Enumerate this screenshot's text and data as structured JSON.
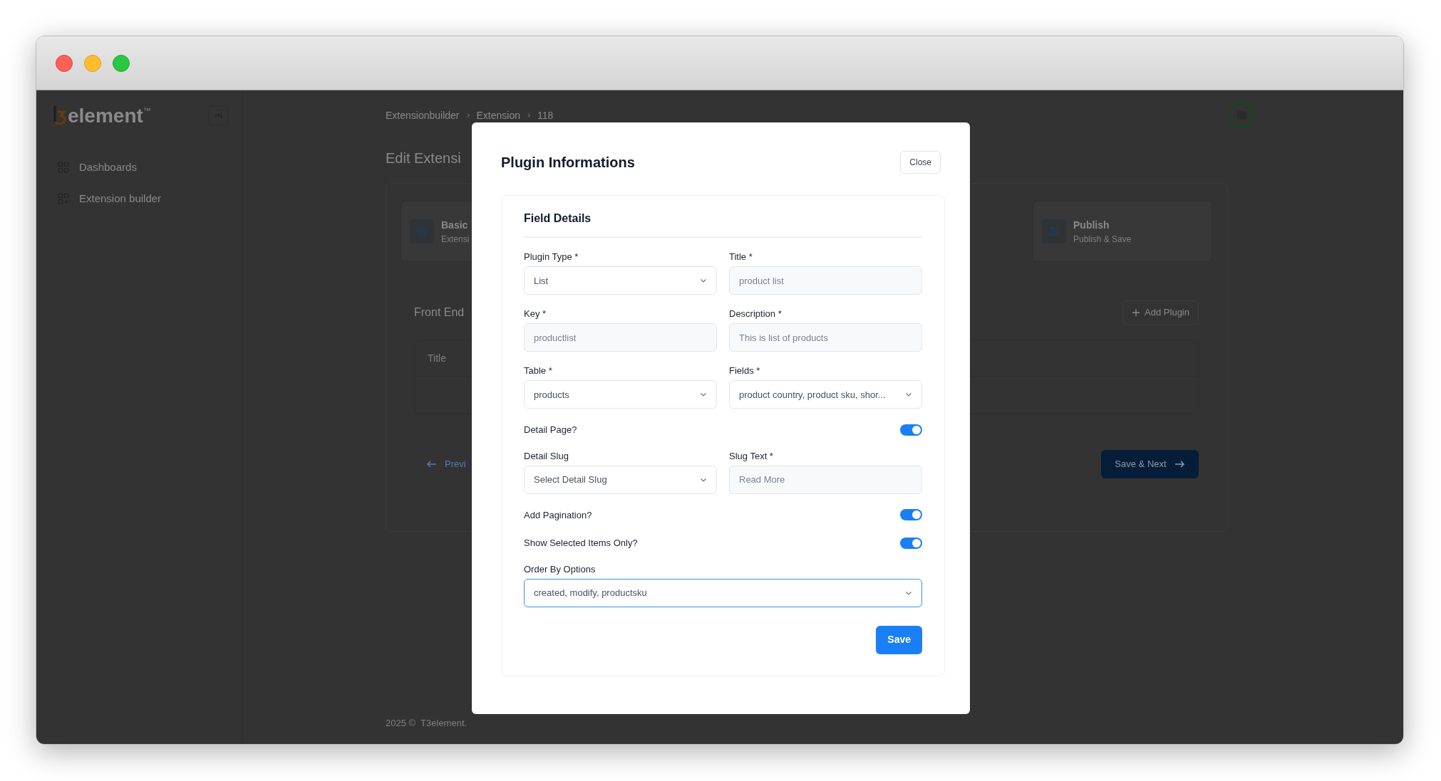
{
  "app": {
    "logo": {
      "text": "element",
      "mark": "™"
    },
    "sidebar": {
      "items": [
        {
          "label": "Dashboards"
        },
        {
          "label": "Extension builder"
        }
      ]
    },
    "breadcrumb": [
      "Extensionbuilder",
      "Extension",
      "118"
    ],
    "page_title": "Edit Extensi",
    "steps": [
      {
        "title": "Basic",
        "subtitle": "Extensi"
      },
      {
        "title": "Publish",
        "subtitle": "Publish & Save"
      }
    ],
    "section_title": "Front End",
    "add_button": "Add Plugin",
    "table": {
      "columns": [
        "Title"
      ]
    },
    "prev_button": "Previ",
    "next_button": "Save & Next",
    "footer": "2025 ©  T3element."
  },
  "modal": {
    "title": "Plugin Informations",
    "close": "Close",
    "card": {
      "title": "Field Details",
      "rows": [
        [
          {
            "kind": "select",
            "label": "Plugin Type *",
            "value": "List",
            "focused": false
          },
          {
            "kind": "input",
            "label": "Title *",
            "placeholder": "product list",
            "focused": false
          }
        ],
        [
          {
            "kind": "input",
            "label": "Key *",
            "placeholder": "productlist",
            "focused": false
          },
          {
            "kind": "input",
            "label": "Description *",
            "placeholder": "This is list of products",
            "focused": false
          }
        ],
        [
          {
            "kind": "select",
            "label": "Table *",
            "value": "products",
            "focused": false
          },
          {
            "kind": "select",
            "label": "Fields *",
            "value": "product country, product sku, shor...",
            "focused": false
          }
        ],
        [
          {
            "kind": "toggle",
            "label": "Detail Page?",
            "on": true
          }
        ],
        [
          {
            "kind": "select",
            "label": "Detail Slug",
            "value": "Select Detail Slug",
            "focused": false
          },
          {
            "kind": "input",
            "label": "Slug Text *",
            "placeholder": "Read More",
            "focused": false
          }
        ],
        [
          {
            "kind": "toggle",
            "label": "Add Pagination?",
            "on": true
          }
        ],
        [
          {
            "kind": "toggle",
            "label": "Show Selected Items Only?",
            "on": true
          }
        ],
        [
          {
            "kind": "select",
            "label": "Order By Options",
            "value": "created, modify, productsku",
            "focused": true
          }
        ]
      ],
      "save": "Save"
    }
  }
}
